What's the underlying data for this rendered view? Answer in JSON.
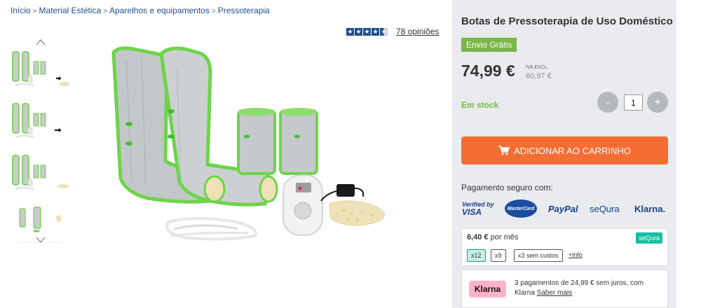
{
  "breadcrumb": [
    {
      "label": "Início"
    },
    {
      "label": "Material Estética"
    },
    {
      "label": "Aparelhos e equipamentos"
    },
    {
      "label": "Pressoterapia"
    }
  ],
  "breadcrumb_separator": ">",
  "rating": {
    "stars": 4.5,
    "reviews_label": "78 opiniões"
  },
  "gallery": {
    "nav_up_icon": "chevron-up-icon",
    "nav_down_icon": "chevron-down-icon",
    "thumbnail_count": 4
  },
  "product": {
    "title": "Botas de Pressoterapia de Uso Doméstico",
    "free_shipping": "Envio Grátis",
    "price": "74,99 €",
    "vat_label": "IVA EXCL.",
    "price_ex_vat": "60,97 €",
    "stock": "Em stock",
    "quantity": "1",
    "minus_label": "-",
    "plus_label": "+",
    "add_to_cart": "ADICIONAR AO CARRINHO",
    "add_to_cart_icon": "cart-icon"
  },
  "payment": {
    "title": "Pagamento seguro com:",
    "logos": {
      "visa_line1": "Verified by",
      "visa_line2": "VISA",
      "mastercard": "MasterCard",
      "paypal": "PayPal",
      "sequra": "seQura",
      "klarna": "Klarna."
    }
  },
  "sequra": {
    "amount": "6,40 €",
    "per_month": " por mês",
    "badge": "seQura",
    "options": [
      "x12",
      "x9",
      "x3 sem custos"
    ],
    "selected_option": "x12",
    "info": "+info"
  },
  "klarna": {
    "badge": "Klarna",
    "text": "3 pagamentos de 24,99 € sem juros, com Klarna",
    "more": "Saber mais"
  },
  "colors": {
    "accent_green": "#7ab648",
    "cart_orange": "#f46d33",
    "panel_bg": "#e9ebee",
    "link_blue": "#1f4e8c",
    "sequra_teal": "#16c0a4",
    "klarna_pink": "#ffb3c7"
  }
}
